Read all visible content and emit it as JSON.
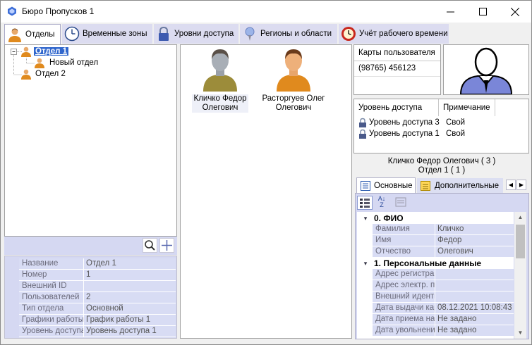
{
  "window": {
    "title": "Бюро Пропусков 1"
  },
  "tabs": [
    {
      "label": "Отделы",
      "icon": "person-icon"
    },
    {
      "label": "Временные зоны",
      "icon": "clock-icon"
    },
    {
      "label": "Уровни доступа",
      "icon": "lock-icon"
    },
    {
      "label": "Регионы и области",
      "icon": "pin-icon"
    },
    {
      "label": "Учёт рабочего времени",
      "icon": "alarm-clock-icon"
    }
  ],
  "tree": {
    "nodes": [
      {
        "label": "Отдел 1",
        "selected": true
      },
      {
        "label": "Новый отдел"
      },
      {
        "label": "Отдел 2"
      }
    ]
  },
  "users": [
    {
      "name": "Кличко Федор Олегович"
    },
    {
      "name": "Расторгуев Олег Олегович"
    }
  ],
  "dept_props": [
    {
      "name": "Название",
      "value": "Отдел 1"
    },
    {
      "name": "Номер",
      "value": "1"
    },
    {
      "name": "Внешний ID",
      "value": ""
    },
    {
      "name": "Пользователей",
      "value": "2"
    },
    {
      "name": "Тип отдела",
      "value": "Основной"
    },
    {
      "name": "Графики работы",
      "value": "График работы 1"
    },
    {
      "name": "Уровень доступа",
      "value": "Уровень доступа 1"
    }
  ],
  "cards": {
    "header": "Карты пользователя",
    "items": [
      "(98765) 456123"
    ]
  },
  "access": {
    "col1": "Уровень доступа",
    "col2": "Примечание",
    "rows": [
      {
        "level": "Уровень доступа 3",
        "note": "Свой"
      },
      {
        "level": "Уровень доступа 1",
        "note": "Свой"
      }
    ]
  },
  "user_info": {
    "line1": "Кличко Федор Олегович ( 3 )",
    "line2": "Отдел 1 ( 1 )"
  },
  "subtabs": [
    "Основные",
    "Дополнительные"
  ],
  "user_props": {
    "groups": [
      {
        "title": "0. ФИО",
        "rows": [
          {
            "name": "Фамилия",
            "value": "Кличко"
          },
          {
            "name": "Имя",
            "value": "Федор"
          },
          {
            "name": "Отчество",
            "value": "Олегович"
          }
        ]
      },
      {
        "title": "1. Персональные данные",
        "rows": [
          {
            "name": "Адрес регистрац",
            "value": ""
          },
          {
            "name": "Адрес электр. по",
            "value": ""
          },
          {
            "name": "Внешний иденти",
            "value": ""
          },
          {
            "name": "Дата выдачи кар",
            "value": "08.12.2021 10:08:43"
          },
          {
            "name": "Дата приема на",
            "value": "Не задано"
          },
          {
            "name": "Дата увольнени",
            "value": "Не задано"
          }
        ]
      }
    ]
  }
}
